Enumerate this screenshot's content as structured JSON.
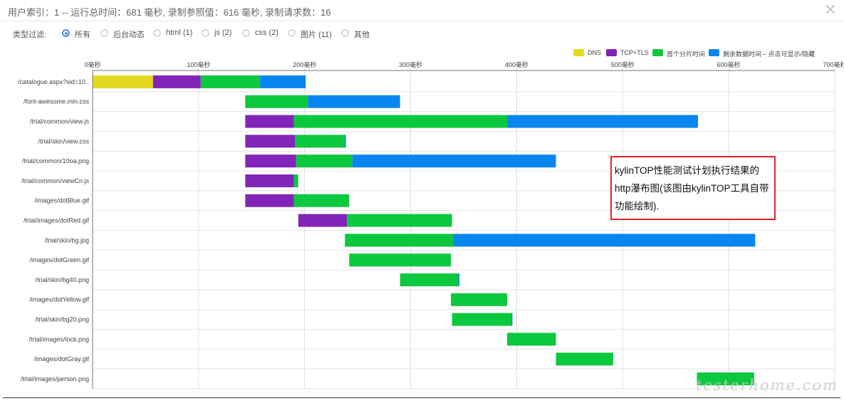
{
  "header": {
    "title": "用户索引：1 -- 运行总时间：681 毫秒, 录制参照值：616 毫秒, 录制请求数：16",
    "close_symbol": "✕"
  },
  "filter": {
    "label": "类型过滤:",
    "options": [
      {
        "label": "所有",
        "checked": true
      },
      {
        "label": "后台动态",
        "checked": false
      },
      {
        "label": "html (1)",
        "checked": false
      },
      {
        "label": "js (2)",
        "checked": false
      },
      {
        "label": "css (2)",
        "checked": false
      },
      {
        "label": "图片 (11)",
        "checked": false
      },
      {
        "label": "其他",
        "checked": false
      }
    ]
  },
  "legend": {
    "items": [
      {
        "label": "DNS",
        "color": "#e5d91f"
      },
      {
        "label": "TCP+TLS",
        "color": "#8224b8"
      },
      {
        "label": "首个分片时间",
        "color": "#0bc83e"
      },
      {
        "label": "剩余数据时间",
        "color": "#0a86f0"
      }
    ],
    "hint": "-- 点击可显示/隐藏"
  },
  "chart_data": {
    "type": "bar",
    "orientation": "horizontal-stacked-waterfall",
    "x_unit": "毫秒",
    "xlim": [
      0,
      700
    ],
    "x_ticks": [
      0,
      100,
      200,
      300,
      400,
      500,
      600,
      700
    ],
    "x_tick_labels": [
      "0毫秒",
      "100毫秒",
      "200毫秒",
      "300毫秒",
      "400毫秒",
      "500毫秒",
      "600毫秒",
      "700毫秒"
    ],
    "legend_position": "top-right",
    "grid": true,
    "series_names": [
      "DNS",
      "TCP+TLS",
      "首个分片时间",
      "剩余数据时间"
    ],
    "series_colors": [
      "#e5d91f",
      "#8224b8",
      "#0bc83e",
      "#0a86f0"
    ],
    "categories": [
      "/catalogue.aspx?sid=10..",
      "/font-awesome.min.css",
      "/trial/common/view.js",
      "/trial/skin/view.css",
      "/trial/common/10oa.png",
      "/trial/common/viewCn.js",
      "/images/dotBlue.gif",
      "/trial/images/dotRed.gif",
      "/trial/skin/bg.jpg",
      "/images/dotGreen.gif",
      "/trial/skin/bg40.png",
      "/images/dotYellow.gif",
      "/trial/skin/bg20.png",
      "/trial/images/lock.png",
      "/images/dotGray.gif",
      "/trial/images/person.png"
    ],
    "rows": [
      {
        "start": 0,
        "dns": 57,
        "tcp": 45,
        "first": 56,
        "rest": 43
      },
      {
        "start": 144,
        "dns": 0,
        "tcp": 0,
        "first": 59,
        "rest": 87
      },
      {
        "start": 144,
        "dns": 0,
        "tcp": 46,
        "first": 201,
        "rest": 180
      },
      {
        "start": 144,
        "dns": 0,
        "tcp": 47,
        "first": 47,
        "rest": 1
      },
      {
        "start": 144,
        "dns": 0,
        "tcp": 48,
        "first": 53,
        "rest": 192
      },
      {
        "start": 144,
        "dns": 0,
        "tcp": 46,
        "first": 4,
        "rest": 0
      },
      {
        "start": 144,
        "dns": 0,
        "tcp": 46,
        "first": 52,
        "rest": 0
      },
      {
        "start": 194,
        "dns": 0,
        "tcp": 46,
        "first": 99,
        "rest": 0
      },
      {
        "start": 238,
        "dns": 0,
        "tcp": 0,
        "first": 102,
        "rest": 285
      },
      {
        "start": 242,
        "dns": 0,
        "tcp": 0,
        "first": 96,
        "rest": 0
      },
      {
        "start": 290,
        "dns": 0,
        "tcp": 0,
        "first": 55,
        "rest": 1
      },
      {
        "start": 338,
        "dns": 0,
        "tcp": 0,
        "first": 53,
        "rest": 0
      },
      {
        "start": 339,
        "dns": 0,
        "tcp": 0,
        "first": 56,
        "rest": 1
      },
      {
        "start": 391,
        "dns": 0,
        "tcp": 0,
        "first": 46,
        "rest": 0
      },
      {
        "start": 437,
        "dns": 0,
        "tcp": 0,
        "first": 54,
        "rest": 0
      },
      {
        "start": 570,
        "dns": 0,
        "tcp": 0,
        "first": 54,
        "rest": 0
      }
    ]
  },
  "annotation": {
    "text": "kylinTOP性能测试计划执行结果的http瀑布图(该图由kylinTOP工具自带功能绘制)."
  },
  "watermark": "testerhome.com"
}
